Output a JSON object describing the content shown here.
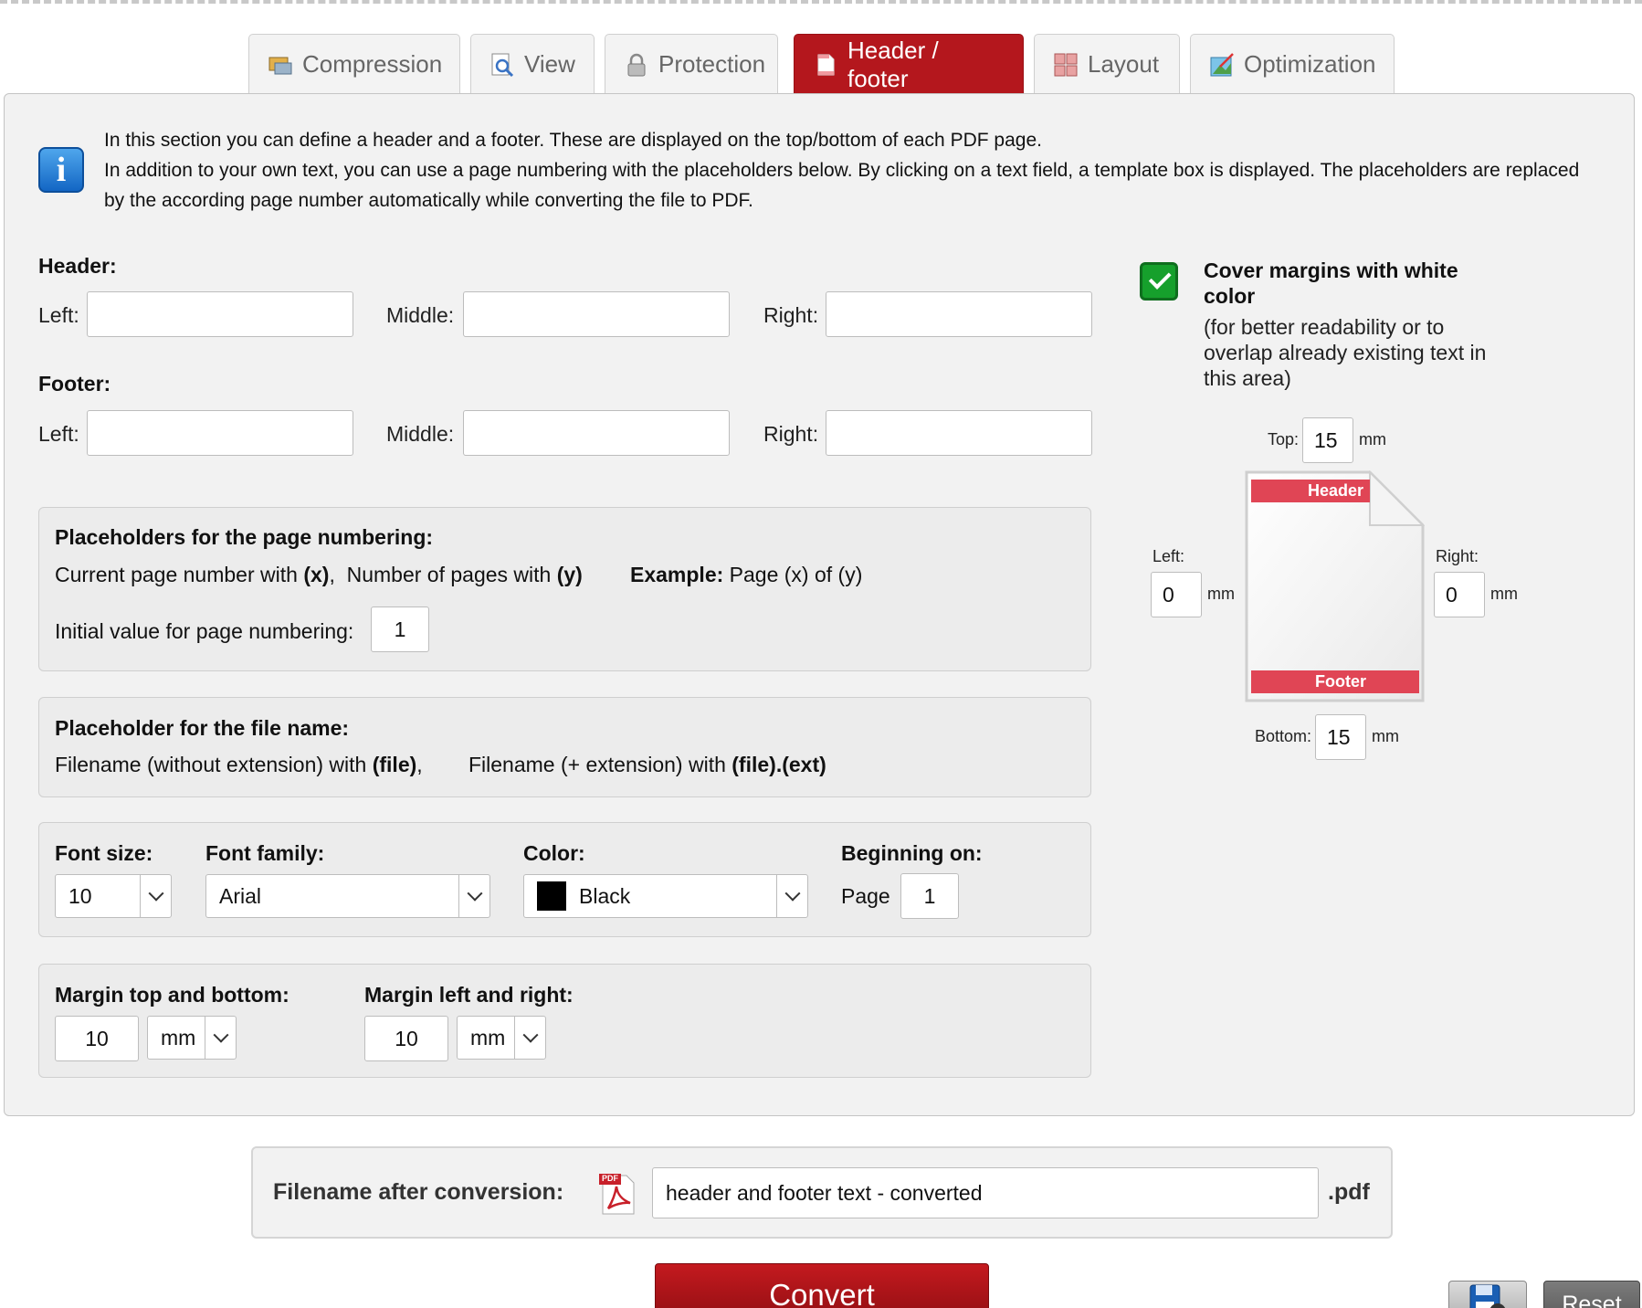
{
  "tabs": [
    {
      "label": "Compression",
      "icon": "compression-icon",
      "active": false
    },
    {
      "label": "View",
      "icon": "view-icon",
      "active": false
    },
    {
      "label": "Protection",
      "icon": "lock-icon",
      "active": false
    },
    {
      "label": "Header / footer",
      "icon": "page-icon",
      "active": true
    },
    {
      "label": "Layout",
      "icon": "layout-grid-icon",
      "active": false
    },
    {
      "label": "Optimization",
      "icon": "optimization-icon",
      "active": false
    }
  ],
  "intro": {
    "line1": "In this section you can define a header and a footer. These are displayed on the top/bottom of each PDF page.",
    "line2": "In addition to your own text, you can use a page numbering with the placeholders below. By clicking on a text field, a template box is displayed. The placeholders are replaced by the according page number automatically while converting the file to PDF."
  },
  "header": {
    "title": "Header:",
    "left_label": "Left:",
    "left_value": "",
    "middle_label": "Middle:",
    "middle_value": "",
    "right_label": "Right:",
    "right_value": ""
  },
  "footer": {
    "title": "Footer:",
    "left_label": "Left:",
    "left_value": "",
    "middle_label": "Middle:",
    "middle_value": "",
    "right_label": "Right:",
    "right_value": ""
  },
  "page_numbering": {
    "title": "Placeholders for the page numbering:",
    "current_text": "Current page number with ",
    "current_ph": "(x)",
    "sep": ",",
    "count_text": "Number of pages with ",
    "count_ph": "(y)",
    "example_label": "Example:",
    "example_value": "Page (x) of (y)",
    "initial_label": "Initial value for page numbering:",
    "initial_value": "1"
  },
  "file_name_ph": {
    "title": "Placeholder for the file name:",
    "without_text": "Filename (without extension) with ",
    "without_ph": "(file)",
    "sep": ",",
    "with_text": "Filename (+ extension) with ",
    "with_ph": "(file).(ext)"
  },
  "font": {
    "size_label": "Font size:",
    "size_value": "10",
    "family_label": "Font family:",
    "family_value": "Arial",
    "color_label": "Color:",
    "color_value": "Black",
    "color_hex": "#000000",
    "begin_label": "Beginning on:",
    "begin_prefix": "Page",
    "begin_value": "1"
  },
  "margins": {
    "tb_label": "Margin top and bottom:",
    "tb_value": "10",
    "tb_unit": "mm",
    "lr_label": "Margin left and right:",
    "lr_value": "10",
    "lr_unit": "mm"
  },
  "cover": {
    "checked": true,
    "title": "Cover margins with white color",
    "subtitle": "(for better readability or to overlap already existing text in this area)",
    "top_label": "Top:",
    "top_value": "15",
    "top_unit": "mm",
    "left_label": "Left:",
    "left_value": "0",
    "left_unit": "mm",
    "right_label": "Right:",
    "right_value": "0",
    "right_unit": "mm",
    "bottom_label": "Bottom:",
    "bottom_value": "15",
    "bottom_unit": "mm",
    "preview_header": "Header",
    "preview_footer": "Footer"
  },
  "filename": {
    "label": "Filename after conversion:",
    "value": "header and footer text - converted",
    "ext": ".pdf",
    "icon_text": "PDF"
  },
  "actions": {
    "convert": "Convert",
    "save_icon": "save-settings-icon",
    "reset": "Reset"
  },
  "colors": {
    "accent": "#b4171d",
    "check": "#16a02c",
    "preview_band": "#e04555"
  }
}
